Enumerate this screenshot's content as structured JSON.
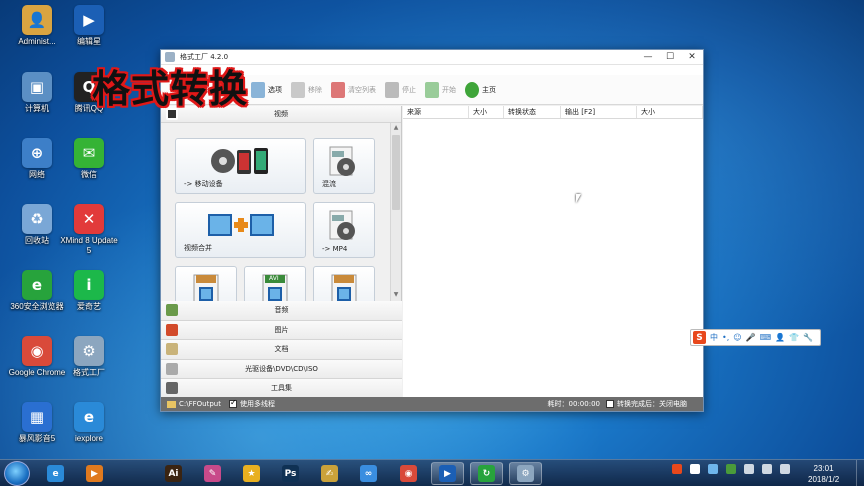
{
  "overlay": {
    "title": "格式转换"
  },
  "desktop_icons": [
    {
      "label": "Administ...",
      "color": "#d9a441",
      "glyph": "👤"
    },
    {
      "label": "编辑星",
      "color": "#1b5fb5",
      "glyph": "▶"
    },
    {
      "label": "计算机",
      "color": "#5b8fc4",
      "glyph": "▣"
    },
    {
      "label": "腾讯QQ",
      "color": "#222222",
      "glyph": "Q"
    },
    {
      "label": "网络",
      "color": "#3d7fc8",
      "glyph": "⊕"
    },
    {
      "label": "微信",
      "color": "#35b335",
      "glyph": "✉"
    },
    {
      "label": "回收站",
      "color": "#7aa7d6",
      "glyph": "♻"
    },
    {
      "label": "XMind 8 Update 5",
      "color": "#e23a3a",
      "glyph": "✕"
    },
    {
      "label": "360安全浏览器",
      "color": "#27a33c",
      "glyph": "e"
    },
    {
      "label": "爱奇艺",
      "color": "#1cb84a",
      "glyph": "i"
    },
    {
      "label": "Google Chrome",
      "color": "#d94a3a",
      "glyph": "◉"
    },
    {
      "label": "格式工厂",
      "color": "#8ca6bf",
      "glyph": "⚙"
    },
    {
      "label": "暴风影音5",
      "color": "#2a6fd1",
      "glyph": "▦"
    },
    {
      "label": "iexplore",
      "color": "#2a8ad8",
      "glyph": "e"
    }
  ],
  "window": {
    "title": "格式工厂 4.2.0",
    "menu_fragment": "",
    "toolbar": [
      {
        "label": "选项",
        "icon": "options-icon",
        "active": true
      },
      {
        "label": "移除",
        "icon": "remove-icon",
        "active": false
      },
      {
        "label": "清空列表",
        "icon": "clear-list-icon",
        "active": false
      },
      {
        "label": "停止",
        "icon": "stop-icon",
        "active": false
      },
      {
        "label": "开始",
        "icon": "start-icon",
        "active": false
      },
      {
        "label": "主页",
        "icon": "home-icon",
        "active": true
      }
    ],
    "categories_top": {
      "label": "视频",
      "icon": "video-icon"
    },
    "tiles": [
      {
        "label": "-> 移动设备",
        "icon": "mobile-device-icon"
      },
      {
        "label": "混流",
        "icon": "mux-icon"
      },
      {
        "label": "视频合并",
        "icon": "video-merge-icon"
      },
      {
        "label": "-> MP4",
        "icon": "mp4-icon"
      },
      {
        "label": "",
        "icon": "format-icon"
      },
      {
        "label": "",
        "icon": "avi-icon",
        "badge": "AVI"
      },
      {
        "label": "",
        "icon": "format-icon"
      }
    ],
    "categories_bottom": [
      {
        "label": "音频",
        "icon": "audio-icon"
      },
      {
        "label": "图片",
        "icon": "picture-icon"
      },
      {
        "label": "文档",
        "icon": "document-icon"
      },
      {
        "label": "光驱设备\\DVD\\CD\\ISO",
        "icon": "disc-icon"
      },
      {
        "label": "工具集",
        "icon": "tools-icon"
      }
    ],
    "columns": [
      "来源",
      "大小",
      "转换状态",
      "输出 [F2]",
      "大小"
    ],
    "status": {
      "output_path": "C:\\FFOutput",
      "multithread_label": "使用多线程",
      "elapsed_label": "耗时：00:00:00",
      "after_label": "转换完成后：关闭电脑"
    }
  },
  "ime": {
    "items": [
      "中",
      "•,",
      "☺",
      "🎤",
      "⌨",
      "👤",
      "👕",
      "🔧"
    ]
  },
  "taskbar": {
    "apps": [
      {
        "name": "ie",
        "color": "#2a8ad8",
        "glyph": "e",
        "running": false
      },
      {
        "name": "media-player",
        "color": "#e07a1f",
        "glyph": "▶",
        "running": false
      },
      {
        "name": "illustrator",
        "color": "#3a2412",
        "glyph": "Ai",
        "running": false
      },
      {
        "name": "paint",
        "color": "#c84a8a",
        "glyph": "✎",
        "running": false
      },
      {
        "name": "sticky",
        "color": "#e8b020",
        "glyph": "★",
        "running": false
      },
      {
        "name": "photoshop",
        "color": "#0f3154",
        "glyph": "Ps",
        "running": false
      },
      {
        "name": "brush",
        "color": "#caa23a",
        "glyph": "✍",
        "running": false
      },
      {
        "name": "cloud",
        "color": "#3a8ee0",
        "glyph": "∞",
        "running": false
      },
      {
        "name": "chrome",
        "color": "#d94a3a",
        "glyph": "◉",
        "running": false
      },
      {
        "name": "editor-star",
        "color": "#1b5fb5",
        "glyph": "▶",
        "running": true
      },
      {
        "name": "360",
        "color": "#27a33c",
        "glyph": "↻",
        "running": true
      },
      {
        "name": "format-factory",
        "color": "#8ca6bf",
        "glyph": "⚙",
        "running": true
      }
    ],
    "clock_time": "23:01",
    "clock_date": "2018/1/2"
  }
}
